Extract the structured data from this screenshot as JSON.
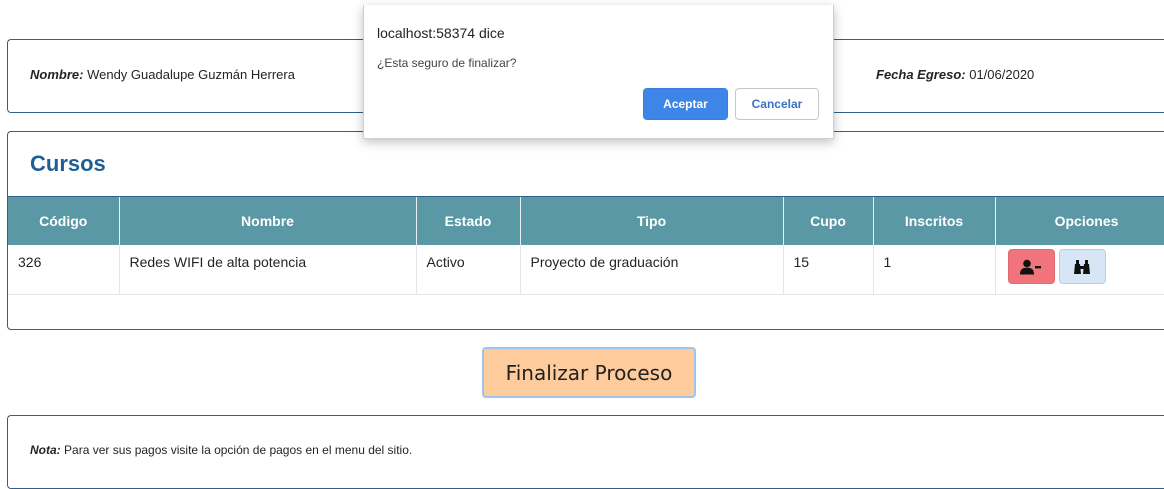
{
  "info": {
    "name_label": "Nombre:",
    "name_value": "Wendy Guadalupe Guzmán Herrera",
    "date_label": "Fecha Egreso:",
    "date_value": "01/06/2020"
  },
  "courses": {
    "title": "Cursos",
    "columns": [
      "Código",
      "Nombre",
      "Estado",
      "Tipo",
      "Cupo",
      "Inscritos",
      "Opciones"
    ],
    "rows": [
      {
        "code": "326",
        "name": "Redes WIFI de alta potencia",
        "status": "Activo",
        "type": "Proyecto de graduación",
        "quota": "15",
        "enrolled": "1"
      }
    ],
    "option_icons": [
      "user-minus-icon",
      "binoculars-icon"
    ],
    "colors": {
      "header": "#5b98a5",
      "remove_button": "#f0747c",
      "view_button": "#d6e6f6",
      "title": "#1f5f96"
    }
  },
  "finalize_button": {
    "label": "Finalizar Proceso",
    "color": "#fecb9d"
  },
  "note": {
    "label": "Nota:",
    "text": "Para ver sus pagos visite la opción de pagos en el menu del sitio."
  },
  "dialog": {
    "title": "localhost:58374 dice",
    "message": "¿Esta seguro de finalizar?",
    "accept_label": "Aceptar",
    "cancel_label": "Cancelar",
    "accept_color": "#3d86e7"
  }
}
